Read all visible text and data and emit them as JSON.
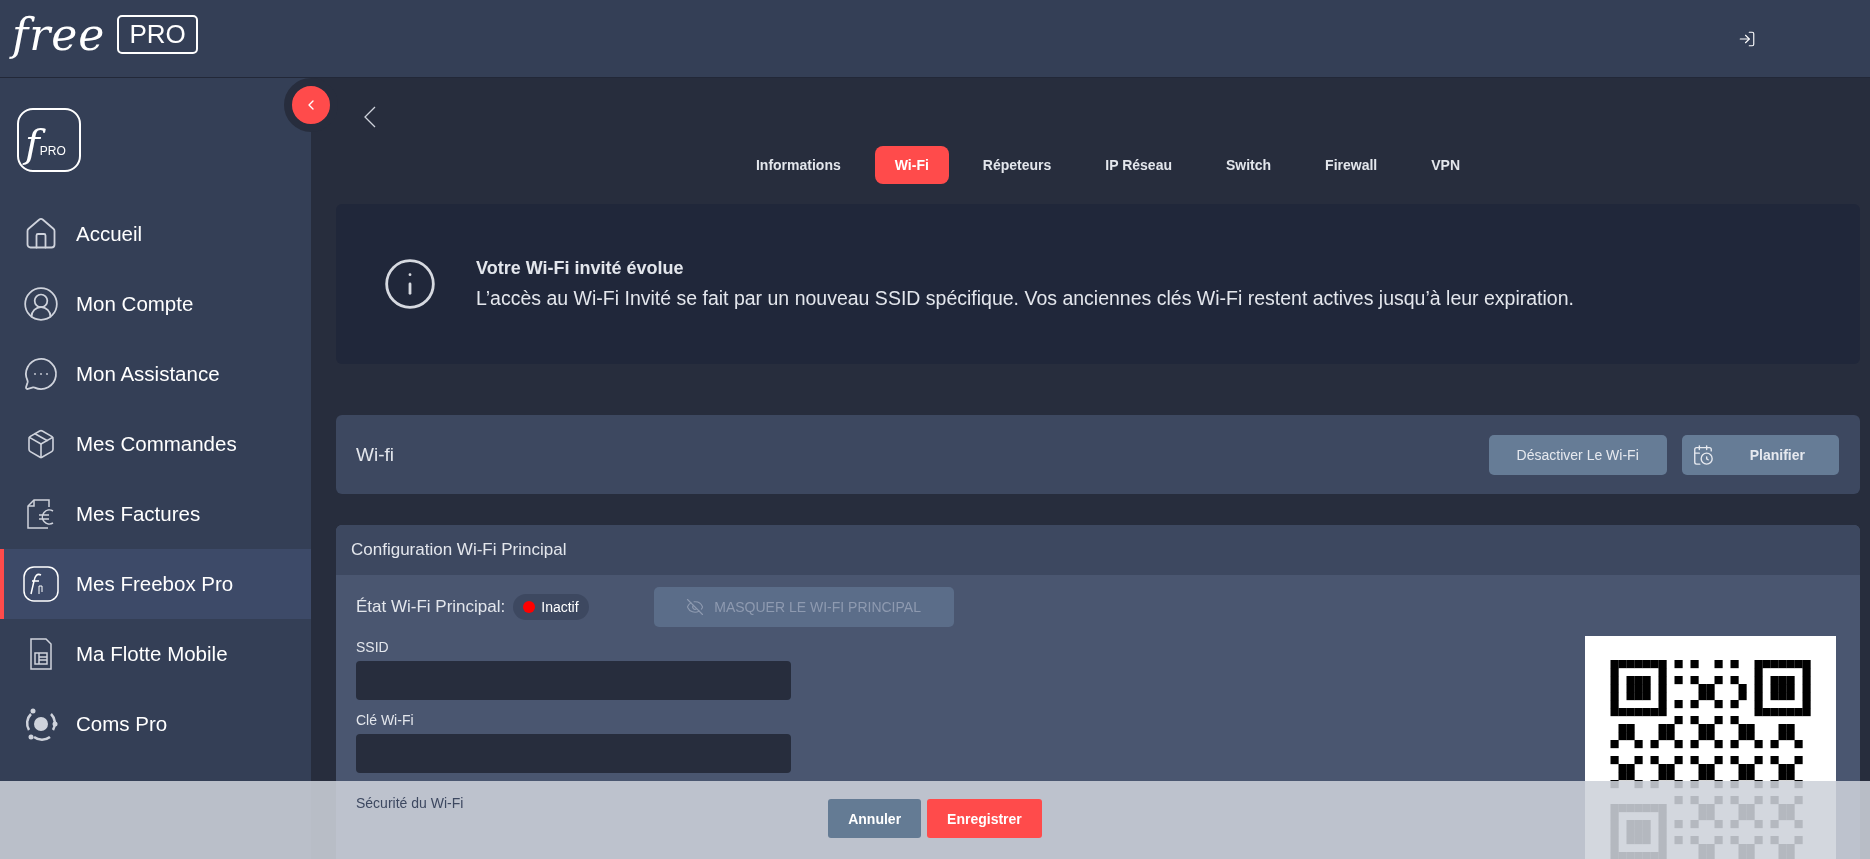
{
  "header": {
    "logo_word": "free",
    "logo_badge": "PRO"
  },
  "sidebar": {
    "logo_letter": "f",
    "logo_badge": "PRO",
    "items": [
      {
        "label": "Accueil",
        "selected": false
      },
      {
        "label": "Mon Compte",
        "selected": false
      },
      {
        "label": "Mon Assistance",
        "selected": false
      },
      {
        "label": "Mes Commandes",
        "selected": false
      },
      {
        "label": "Mes Factures",
        "selected": false
      },
      {
        "label": "Mes Freebox Pro",
        "selected": true
      },
      {
        "label": "Ma Flotte Mobile",
        "selected": false
      },
      {
        "label": "Coms Pro",
        "selected": false
      }
    ]
  },
  "tabs": [
    {
      "label": "Informations",
      "selected": false
    },
    {
      "label": "Wi-Fi",
      "selected": true
    },
    {
      "label": "Répeteurs",
      "selected": false
    },
    {
      "label": "IP Réseau",
      "selected": false
    },
    {
      "label": "Switch",
      "selected": false
    },
    {
      "label": "Firewall",
      "selected": false
    },
    {
      "label": "VPN",
      "selected": false
    }
  ],
  "notice": {
    "title": "Votre Wi-Fi invité évolue",
    "text": "L’accès au Wi-Fi Invité se fait par un nouveau SSID spécifique. Vos anciennes clés Wi-Fi restent actives jusqu’à leur expiration."
  },
  "wifi_card": {
    "title": "Wi-fi",
    "buttons": [
      {
        "label": "Désactiver Le Wi-Fi",
        "kind": "plain"
      },
      {
        "label": "Planifier",
        "kind": "schedule"
      }
    ]
  },
  "config": {
    "title": "Configuration Wi-Fi Principal",
    "status_label": "État Wi-Fi Principal:",
    "status": {
      "label": "Inactif",
      "active": false
    },
    "hide_button": {
      "label": "MASQUER LE WI-FI PRINCIPAL",
      "disabled": true
    },
    "fields": [
      {
        "label": "SSID"
      },
      {
        "label": "Clé Wi-Fi"
      }
    ],
    "security_label": "Sécurité du Wi-Fi"
  },
  "footer": {
    "buttons": [
      {
        "label": "Annuler",
        "kind": "secondary"
      },
      {
        "label": "Enregistrer",
        "kind": "primary"
      }
    ]
  }
}
